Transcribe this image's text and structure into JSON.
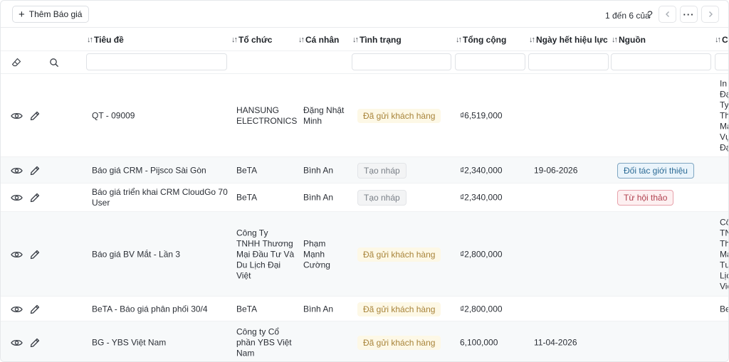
{
  "toolbar": {
    "add_label": "Thêm Báo giá",
    "pager_text": "1 đến 6 của",
    "help_glyph": "?",
    "more_glyph": "···"
  },
  "columns": [
    "Tiêu đề",
    "Tổ chức",
    "Cá nhân",
    "Tình trạng",
    "Tổng cộng",
    "Ngày hết hiệu lực",
    "Nguồn",
    "C"
  ],
  "rows": [
    {
      "title": [
        "QT - 09009"
      ],
      "org": [
        "HANSUNG",
        "ELECTRONICS"
      ],
      "person": [
        "Đặng Nhật",
        "Minh"
      ],
      "status": "Đã gửi khách hàng",
      "total": "₫6,519,000",
      "expiry": "",
      "source": "",
      "extra": [
        "In",
        "Đạ",
        "Ty",
        "Th",
        "Mạ",
        "Vụ",
        "Đạ"
      ]
    },
    {
      "title": [
        "Báo giá CRM - Pijsco Sài Gòn"
      ],
      "org": [
        "BeTA"
      ],
      "person": [
        "Bình An"
      ],
      "status": "Tạo nháp",
      "total": "₫2,340,000",
      "expiry": "19-06-2026",
      "source": "Đối tác giới thiệu",
      "extra": []
    },
    {
      "title": [
        "Báo giá triển khai CRM CloudGo 70",
        "User"
      ],
      "org": [
        "BeTA"
      ],
      "person": [
        "Bình An"
      ],
      "status": "Tạo nháp",
      "total": "₫2,340,000",
      "expiry": "",
      "source": "Từ hội thảo",
      "extra": []
    },
    {
      "title": [
        "Báo giá BV Mắt - Lần 3"
      ],
      "org": [
        "Công Ty",
        "TNHH Thương",
        "Mại Đầu Tư Và",
        "Du Lịch Đại",
        "Việt"
      ],
      "person": [
        "Phạm",
        "Mạnh",
        "Cường"
      ],
      "status": "Đã gửi khách hàng",
      "total": "₫2,800,000",
      "expiry": "",
      "source": "",
      "extra": [
        "Cô",
        "TN",
        "Th",
        "Mạ",
        "Tư",
        "Lịc",
        "Việ"
      ]
    },
    {
      "title": [
        "BeTA - Báo giá phân phối 30/4"
      ],
      "org": [
        "BeTA"
      ],
      "person": [
        "Bình An"
      ],
      "status": "Đã gửi khách hàng",
      "total": "₫2,800,000",
      "expiry": "",
      "source": "",
      "extra": [
        "Be"
      ]
    },
    {
      "title": [
        "BG - YBS Việt Nam"
      ],
      "org": [
        "Công ty Cổ",
        "phần YBS Việt",
        "Nam"
      ],
      "person": [],
      "status": "Đã gửi khách hàng",
      "total": "6,100,000",
      "expiry": "11-04-2026",
      "source": "",
      "extra": []
    }
  ],
  "colors": {
    "sent_bg": "#fdf8e6",
    "sent_text": "#a8843a",
    "partner_border": "#7fa6c2",
    "seminar_border": "#e8a2ab"
  }
}
